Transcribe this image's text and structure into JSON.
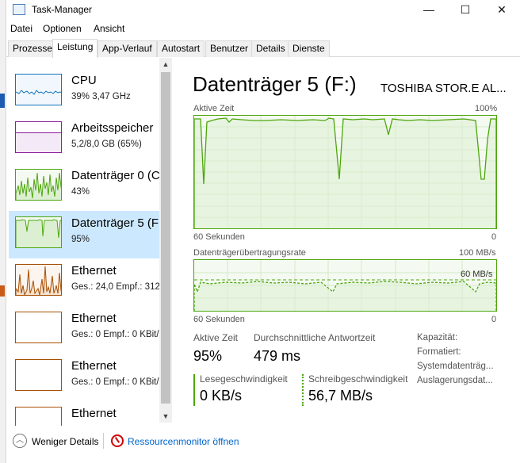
{
  "window": {
    "title": "Task-Manager"
  },
  "window_controls": {
    "minimize": "—",
    "maximize": "☐",
    "close": "✕"
  },
  "menu": [
    "Datei",
    "Optionen",
    "Ansicht"
  ],
  "tabs": [
    "Prozesse",
    "Leistung",
    "App-Verlauf",
    "Autostart",
    "Benutzer",
    "Details",
    "Dienste"
  ],
  "active_tab": "Leistung",
  "sidebar": {
    "items": [
      {
        "name": "CPU",
        "sub": "39% 3,47 GHz",
        "color": "#1175bd"
      },
      {
        "name": "Arbeitsspeicher",
        "sub": "5,2/8,0 GB (65%)",
        "color": "#8b1f9b"
      },
      {
        "name": "Datenträger 0 (C",
        "sub": "43%",
        "color": "#4da60c"
      },
      {
        "name": "Datenträger 5 (F",
        "sub": "95%",
        "color": "#4da60c",
        "selected": true
      },
      {
        "name": "Ethernet",
        "sub": "Ges.: 24,0  Empf.: 312",
        "color": "#a74f01"
      },
      {
        "name": "Ethernet",
        "sub": "Ges.: 0  Empf.: 0 KBit/",
        "color": "#a74f01"
      },
      {
        "name": "Ethernet",
        "sub": "Ges.: 0  Empf.: 0 KBit/",
        "color": "#a74f01"
      },
      {
        "name": "Ethernet",
        "sub": "",
        "color": "#a74f01"
      }
    ]
  },
  "detail": {
    "title": "Datenträger 5 (F:)",
    "model": "TOSHIBA STOR.E AL...",
    "graph1": {
      "label": "Aktive Zeit",
      "max": "100%",
      "time": "60 Sekunden",
      "min": "0"
    },
    "graph2": {
      "label": "Datenträgerübertragungsrate",
      "max": "100 MB/s",
      "line_label": "60 MB/s",
      "time": "60 Sekunden",
      "min": "0"
    },
    "stats": {
      "active_label": "Aktive Zeit",
      "active_value": "95%",
      "resp_label": "Durchschnittliche Antwortzeit",
      "resp_value": "479 ms",
      "read_label": "Lesegeschwindigkeit",
      "read_value": "0 KB/s",
      "write_label": "Schreibgeschwindigkeit",
      "write_value": "56,7 MB/s"
    },
    "props": [
      "Kapazität:",
      "Formatiert:",
      "Systemdatenträg...",
      "Auslagerungsdat..."
    ]
  },
  "footer": {
    "less_details": "Weniger Details",
    "resource_monitor": "Ressourcenmonitor öffnen"
  },
  "colors": {
    "disk": "#4da60c",
    "cpu": "#1175bd",
    "memory": "#8b1f9b",
    "ethernet": "#a74f01",
    "selection": "#cce8ff",
    "link": "#0066cc"
  }
}
